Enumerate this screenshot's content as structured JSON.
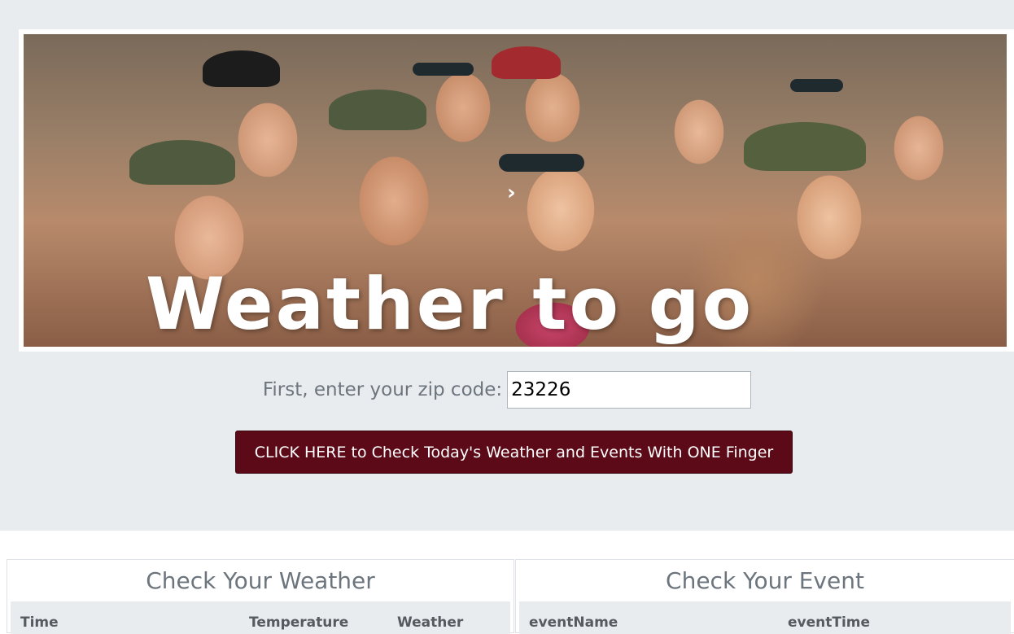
{
  "hero": {
    "title": "Weather to go",
    "arrow_icon": "chevron-right-icon"
  },
  "zip": {
    "label": "First, enter your zip code:",
    "value": "23226"
  },
  "check_button": {
    "label": "CLICK HERE to Check Today's Weather and Events With ONE Finger",
    "color": "#5c0a17"
  },
  "weather_panel": {
    "title": "Check Your Weather",
    "columns": [
      "Time",
      "Temperature",
      "Weather"
    ]
  },
  "event_panel": {
    "title": "Check Your Event",
    "columns": [
      "eventName",
      "eventTime"
    ]
  },
  "colors": {
    "page_background": "#e9ecef",
    "muted_text": "#6c757d"
  }
}
